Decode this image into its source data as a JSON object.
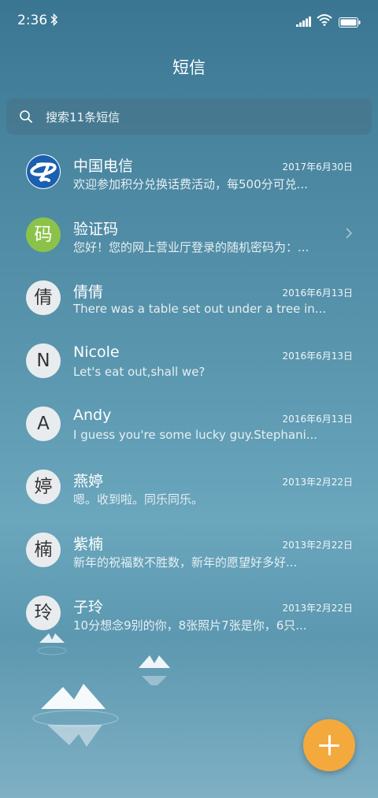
{
  "status_bar": {
    "time": "2:36"
  },
  "header": {
    "title": "短信"
  },
  "search": {
    "placeholder": "搜索11条短信"
  },
  "messages": [
    {
      "sender": "中国电信",
      "preview": "欢迎参加积分兑换话费活动，每500分可兑...",
      "date": "2017年6月30日",
      "avatar": "telecom-logo",
      "avatar_text": ""
    },
    {
      "sender": "验证码",
      "preview": "您好！您的网上营业厅登录的随机密码为：...",
      "date": "",
      "avatar_text": "码",
      "avatar_color": "#8bc34a"
    },
    {
      "sender": "倩倩",
      "preview": "There was a table set out under a tree in...",
      "date": "2016年6月13日",
      "avatar_text": "倩"
    },
    {
      "sender": "Nicole",
      "preview": "Let's eat out,shall we?",
      "date": "2016年6月13日",
      "avatar_text": "N"
    },
    {
      "sender": "Andy",
      "preview": "I guess you're some lucky guy.Stephani...",
      "date": "2016年6月13日",
      "avatar_text": "A"
    },
    {
      "sender": "燕婷",
      "preview": "嗯。收到啦。同乐同乐。",
      "date": "2013年2月22日",
      "avatar_text": "婷"
    },
    {
      "sender": "紫楠",
      "preview": "新年的祝福数不胜数，新年的愿望好多好...",
      "date": "2013年2月22日",
      "avatar_text": "楠"
    },
    {
      "sender": "子玲",
      "preview": "10分想念9别的你，8张照片7张是你，6只...",
      "date": "2013年2月22日",
      "avatar_text": "玲"
    }
  ],
  "colors": {
    "fab": "#f4a93c",
    "verify_avatar": "#8bc34a"
  },
  "icons": [
    "bluetooth-icon",
    "signal-icon",
    "wifi-icon",
    "battery-icon",
    "search-icon",
    "chevron-right-icon",
    "plus-icon"
  ]
}
